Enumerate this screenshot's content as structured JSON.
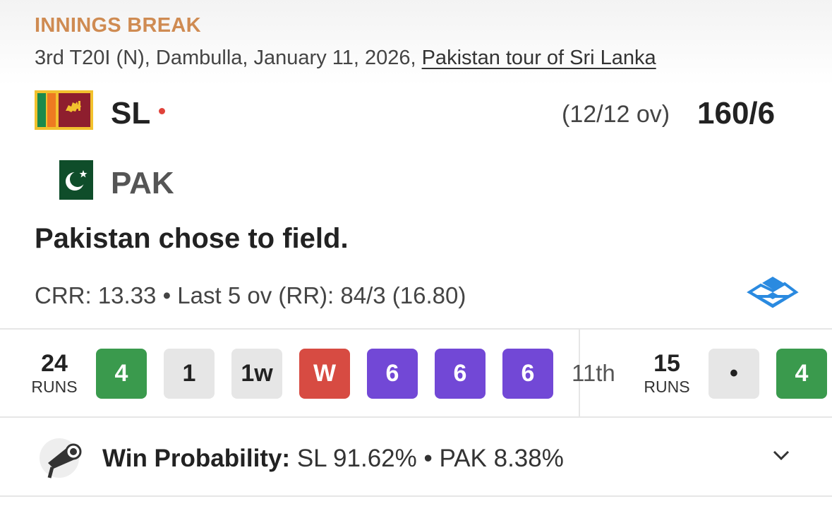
{
  "match": {
    "status": "INNINGS BREAK",
    "info_prefix": "3rd T20I (N), Dambulla, January 11, 2026, ",
    "series_link": "Pakistan tour of Sri Lanka"
  },
  "teams": [
    {
      "code": "SL",
      "overs": "(12/12 ov)",
      "score": "160/6",
      "batting": true
    },
    {
      "code": "PAK",
      "overs": "",
      "score": "",
      "batting": false
    }
  ],
  "toss": "Pakistan chose to field.",
  "rates": "CRR: 13.33 • Last 5 ov (RR): 84/3 (16.80)",
  "over_summary": {
    "current": {
      "runs": "24",
      "runs_label": "RUNS",
      "balls": [
        {
          "label": "4",
          "kind": "boundary"
        },
        {
          "label": "1",
          "kind": "run"
        },
        {
          "label": "1w",
          "kind": "run"
        },
        {
          "label": "W",
          "kind": "wicket"
        },
        {
          "label": "6",
          "kind": "six"
        },
        {
          "label": "6",
          "kind": "six"
        },
        {
          "label": "6",
          "kind": "six"
        }
      ]
    },
    "previous": {
      "over_label": "11th",
      "runs": "15",
      "runs_label": "RUNS",
      "balls": [
        {
          "label": "•",
          "kind": "dot"
        },
        {
          "label": "4",
          "kind": "boundary"
        }
      ]
    }
  },
  "win_probability": {
    "label": "Win Probability:",
    "value": "SL 91.62% • PAK 8.38%"
  },
  "icons": {
    "layers": "layers-icon",
    "mic": "megaphone-icon",
    "expand": "chevron-down-icon",
    "live": "live-dot-icon"
  },
  "colors": {
    "status": "#cf8b52",
    "boundary": "#3a9a4d",
    "wicket": "#d74b42",
    "six": "#7248d6",
    "neutral": "#e6e6e6",
    "live_dot": "#e0423a",
    "layers_icon": "#2a8ae0"
  }
}
